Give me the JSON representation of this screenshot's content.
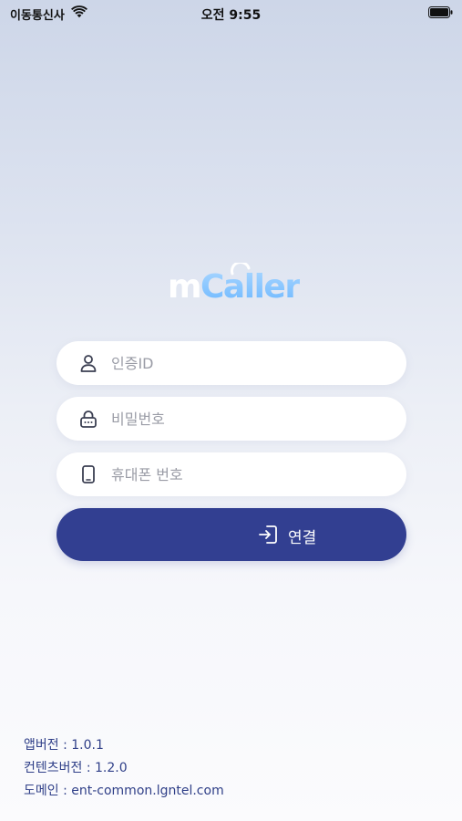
{
  "status_bar": {
    "carrier": "이동통신사",
    "time": "오전 9:55"
  },
  "logo": {
    "text_plain": "m",
    "text_accent": "Caller"
  },
  "form": {
    "auth_id_placeholder": "인증ID",
    "password_placeholder": "비밀번호",
    "phone_placeholder": "휴대폰 번호",
    "connect_label": "연결"
  },
  "footer": {
    "app_version": "앱버전 : 1.0.1",
    "contents_version": "컨텐츠버전 : 1.2.0",
    "domain": "도메인 : ent-common.lgntel.com"
  },
  "colors": {
    "button": "#323f91",
    "footer_text": "#2f3f88",
    "logo_accent": "#6db8ff"
  },
  "icons": [
    "wifi-icon",
    "battery-icon",
    "user-icon",
    "lock-icon",
    "phone-icon",
    "login-icon"
  ]
}
